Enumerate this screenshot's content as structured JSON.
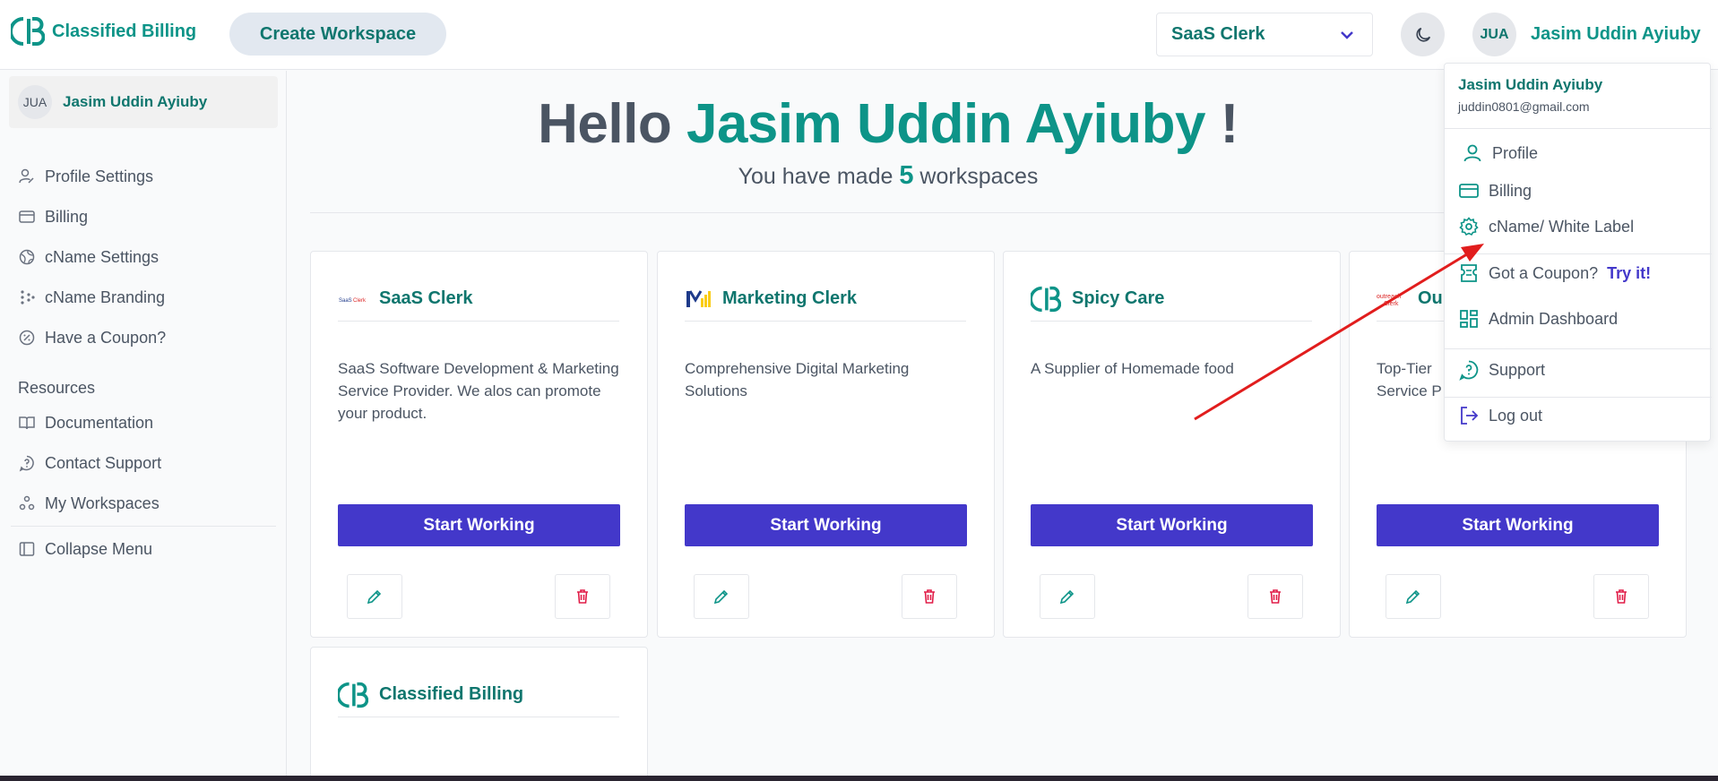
{
  "header": {
    "logo_text": "Classified Billing",
    "create_workspace": "Create Workspace",
    "workspace_select": "SaaS Clerk",
    "user_initials": "JUA",
    "user_name": "Jasim Uddin Ayiuby"
  },
  "sidebar": {
    "user_initials": "JUA",
    "user_name": "Jasim Uddin Ayiuby",
    "items": [
      {
        "label": "Profile Settings",
        "icon": "profile-settings-icon"
      },
      {
        "label": "Billing",
        "icon": "credit-card-icon"
      },
      {
        "label": "cName Settings",
        "icon": "globe-icon"
      },
      {
        "label": "cName Branding",
        "icon": "dots-grid-icon"
      },
      {
        "label": "Have a Coupon?",
        "icon": "coupon-icon"
      }
    ],
    "resources_title": "Resources",
    "resources": [
      {
        "label": "Documentation",
        "icon": "book-icon"
      },
      {
        "label": "Contact Support",
        "icon": "help-icon"
      },
      {
        "label": "My Workspaces",
        "icon": "workspaces-icon"
      }
    ],
    "collapse": "Collapse Menu"
  },
  "main": {
    "hello_prefix": "Hello ",
    "hello_name": "Jasim Uddin Ayiuby",
    "hello_suffix": " !",
    "sub_prefix": "You have made ",
    "sub_count": "5",
    "sub_suffix": " workspaces",
    "cards": [
      {
        "title": "SaaS Clerk",
        "desc": "SaaS Software Development & Marketing Service Provider. We alos can promote your product.",
        "button": "Start Working"
      },
      {
        "title": "Marketing Clerk",
        "desc": "Comprehensive Digital Marketing Solutions",
        "button": "Start Working"
      },
      {
        "title": "Spicy Care",
        "desc": "A Supplier of Homemade food",
        "button": "Start Working"
      },
      {
        "title": "Ou",
        "desc_line1": "Top-Tier",
        "desc_line2": "Service P",
        "button": "Start Working"
      },
      {
        "title": "Classified Billing"
      }
    ]
  },
  "dropdown": {
    "name": "Jasim Uddin Ayiuby",
    "email": "juddin0801@gmail.com",
    "items": [
      {
        "label": "Profile",
        "icon": "user-icon"
      },
      {
        "label": "Billing",
        "icon": "credit-card-icon"
      },
      {
        "label": "cName/ White Label",
        "icon": "gear-icon"
      },
      {
        "label": "Got a Coupon?",
        "link": "Try it!",
        "icon": "ticket-icon"
      },
      {
        "label": "Admin Dashboard",
        "icon": "dashboard-icon"
      },
      {
        "label": "Support",
        "icon": "help-icon"
      },
      {
        "label": "Log out",
        "icon": "logout-icon"
      }
    ]
  },
  "colors": {
    "teal": "#0d9488",
    "indigo": "#4338ca",
    "danger": "#e11d48",
    "annotation_arrow": "#e11d1d"
  }
}
